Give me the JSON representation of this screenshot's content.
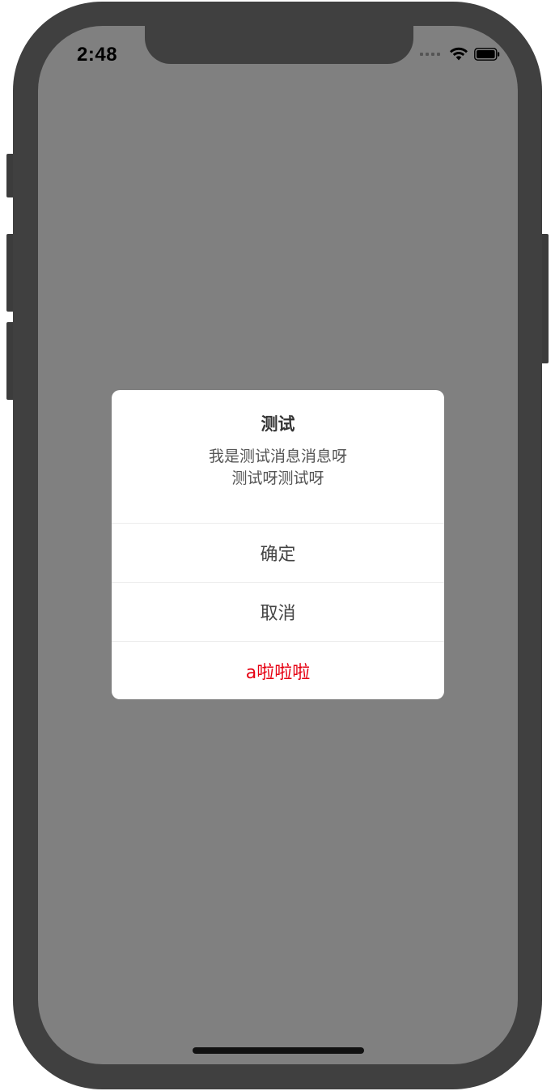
{
  "status_bar": {
    "time": "2:48",
    "icons": [
      "signal-dots-icon",
      "wifi-icon",
      "battery-icon"
    ]
  },
  "dialog": {
    "title": "测试",
    "message_line1": "我是测试消息消息呀",
    "message_line2": "测试呀测试呀",
    "buttons": [
      {
        "label": "确定",
        "color": "#444444"
      },
      {
        "label": "取消",
        "color": "#444444"
      },
      {
        "label": "a啦啦啦",
        "color": "#e60012"
      }
    ]
  },
  "colors": {
    "overlay": "#808080",
    "frame": "#404040",
    "dialog_bg": "#ffffff",
    "accent_red": "#e60012"
  }
}
